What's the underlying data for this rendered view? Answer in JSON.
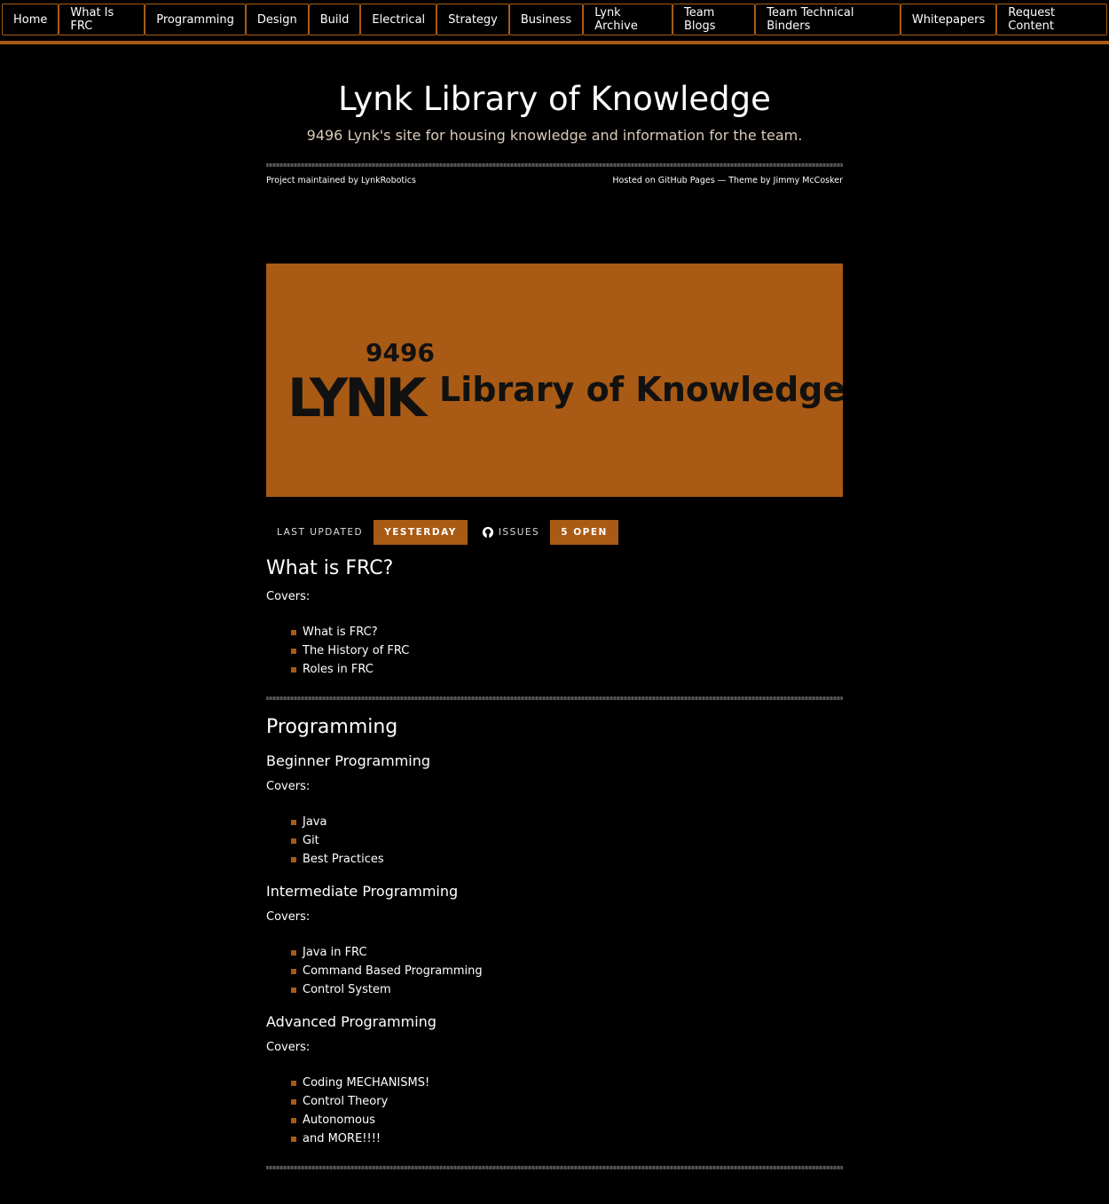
{
  "nav": [
    "Home",
    "What Is FRC",
    "Programming",
    "Design",
    "Build",
    "Electrical",
    "Strategy",
    "Business",
    "Lynk Archive",
    "Team Blogs",
    "Team Technical Binders",
    "Whitepapers",
    "Request Content"
  ],
  "header": {
    "title": "Lynk Library of Knowledge",
    "subtitle": "9496 Lynk's site for housing knowledge and information for the team.",
    "maintained": "Project maintained by LynkRobotics",
    "hosted": "Hosted on GitHub Pages — Theme by Jimmy McCosker"
  },
  "banner": {
    "number": "9496",
    "brand": "LYNK",
    "text": "Library of Knowledge"
  },
  "badges": {
    "updated_label": "LAST UPDATED",
    "updated_value": "YESTERDAY",
    "issues_label": "ISSUES",
    "issues_value": "5 OPEN",
    "icon": "github-icon"
  },
  "colors": {
    "accent": "#a95a14"
  },
  "sections": {
    "frc": {
      "title": "What is FRC?",
      "covers": "Covers:",
      "items": [
        "What is FRC?",
        "The History of FRC",
        "Roles in FRC"
      ]
    },
    "programming": {
      "title": "Programming",
      "beginner": {
        "title": "Beginner Programming",
        "covers": "Covers:",
        "items": [
          "Java",
          "Git",
          "Best Practices"
        ]
      },
      "intermediate": {
        "title": "Intermediate Programming",
        "covers": "Covers:",
        "items": [
          "Java in FRC",
          "Command Based Programming",
          "Control System"
        ]
      },
      "advanced": {
        "title": "Advanced Programming",
        "covers": "Covers:",
        "items": [
          "Coding MECHANISMS!",
          "Control Theory",
          "Autonomous",
          "and MORE!!!!"
        ]
      }
    }
  }
}
